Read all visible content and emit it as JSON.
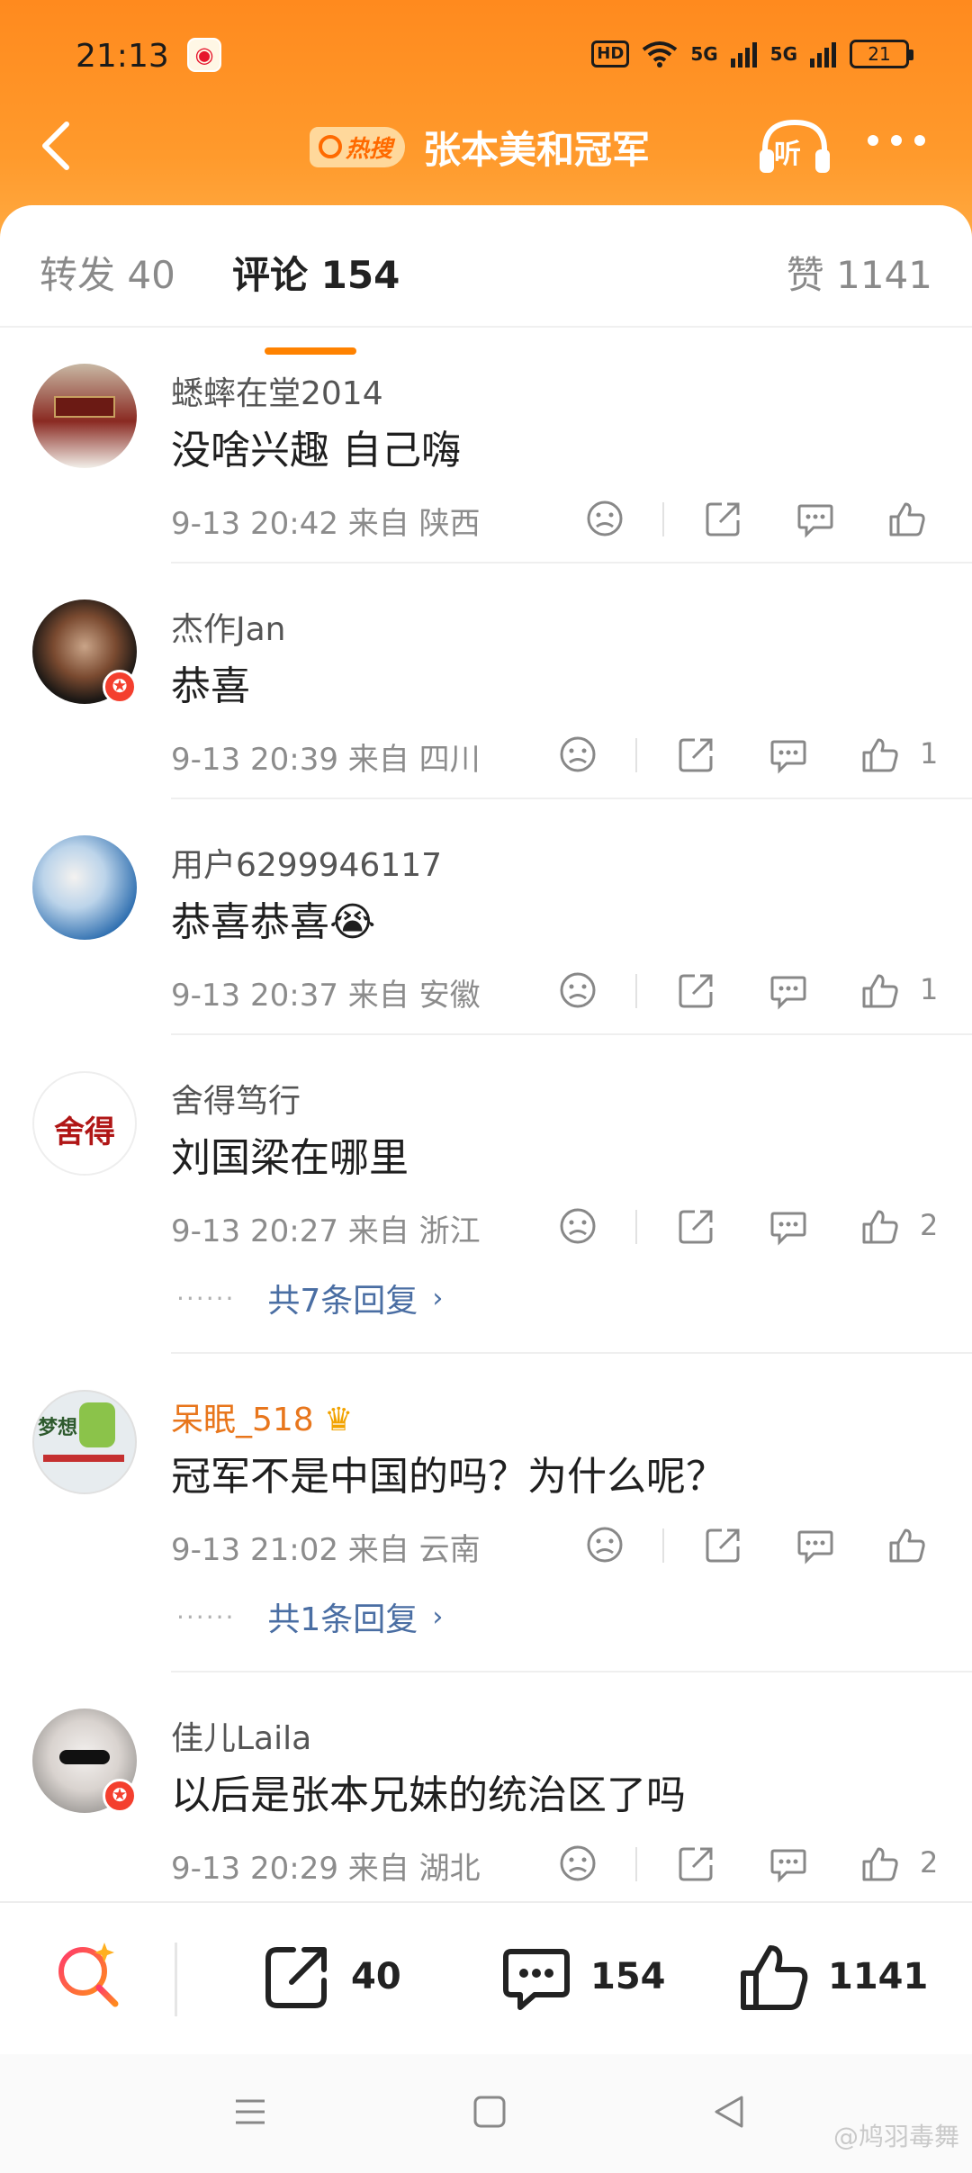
{
  "status_bar": {
    "time": "21:13",
    "network_1": "5G",
    "network_2": "5G",
    "hd_label": "HD",
    "battery": "21"
  },
  "header": {
    "hot_badge": "热搜",
    "title": "张本美和冠军",
    "listen_label": "听"
  },
  "tabs": {
    "repost": "转发 40",
    "comment": "评论 154",
    "like": "赞 1141"
  },
  "comments": [
    {
      "name": "蟋蟀在堂2014",
      "text": "没啥兴趣 自己嗨",
      "time": "9-13 20:42",
      "from": "来自 陕西",
      "likes": ""
    },
    {
      "name": "杰作Jan",
      "text": "恭喜",
      "time": "9-13 20:39",
      "from": "来自 四川",
      "likes": "1"
    },
    {
      "name": "用户6299946117",
      "text": "恭喜恭喜😭",
      "time": "9-13 20:37",
      "from": "来自 安徽",
      "likes": "1"
    },
    {
      "name": "舍得笃行",
      "text": "刘国梁在哪里",
      "time": "9-13 20:27",
      "from": "来自 浙江",
      "likes": "2",
      "replies": "共7条回复"
    },
    {
      "name": "呆眠_518",
      "text": "冠军不是中国的吗？为什么呢？",
      "time": "9-13 21:02",
      "from": "来自 云南",
      "likes": "",
      "replies": "共1条回复"
    },
    {
      "name": "佳儿Laila",
      "text": "以后是张本兄妹的统治区了吗",
      "time": "9-13 20:29",
      "from": "来自 湖北",
      "likes": "2"
    }
  ],
  "avatar_texts": {
    "shede": "舍得",
    "mengxiang": "梦想"
  },
  "bottom_bar": {
    "repost_count": "40",
    "comment_count": "154",
    "like_count": "1141"
  },
  "watermark": "@鸠羽毒舞",
  "colors": {
    "accent": "#ff8200",
    "header_top": "#ff8a1e",
    "link": "#4a6ea3",
    "vip_name": "#e8761c"
  }
}
